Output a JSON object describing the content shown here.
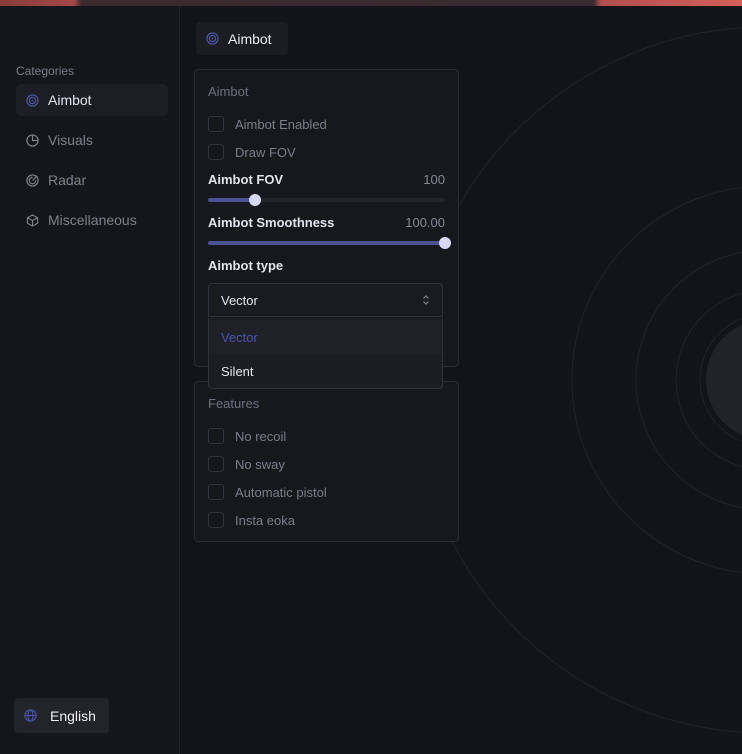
{
  "sidebar": {
    "categories_title": "Categories",
    "items": [
      {
        "label": "Aimbot",
        "icon": "target-icon",
        "active": true
      },
      {
        "label": "Visuals",
        "icon": "chart-pie-icon",
        "active": false
      },
      {
        "label": "Radar",
        "icon": "radar-icon",
        "active": false
      },
      {
        "label": "Miscellaneous",
        "icon": "cube-icon",
        "active": false
      }
    ],
    "language": "English"
  },
  "tab": {
    "label": "Aimbot"
  },
  "aimbot_panel": {
    "title": "Aimbot",
    "checkboxes": [
      {
        "label": "Aimbot Enabled",
        "checked": false
      },
      {
        "label": "Draw FOV",
        "checked": false
      }
    ],
    "fov": {
      "label": "Aimbot FOV",
      "value": "100",
      "fraction": 0.2
    },
    "smoothness": {
      "label": "Aimbot Smoothness",
      "value": "100.00",
      "fraction": 1.0
    },
    "type": {
      "label": "Aimbot type",
      "selected": "Vector",
      "options": [
        "Vector",
        "Silent"
      ]
    }
  },
  "features_panel": {
    "title": "Features",
    "checkboxes": [
      {
        "label": "No recoil",
        "checked": false
      },
      {
        "label": "No sway",
        "checked": false
      },
      {
        "label": "Automatic pistol",
        "checked": false
      },
      {
        "label": "Insta eoka",
        "checked": false
      }
    ]
  },
  "colors": {
    "accent": "#4b5296",
    "thumb": "#d8d8f2",
    "background": "#131419"
  }
}
